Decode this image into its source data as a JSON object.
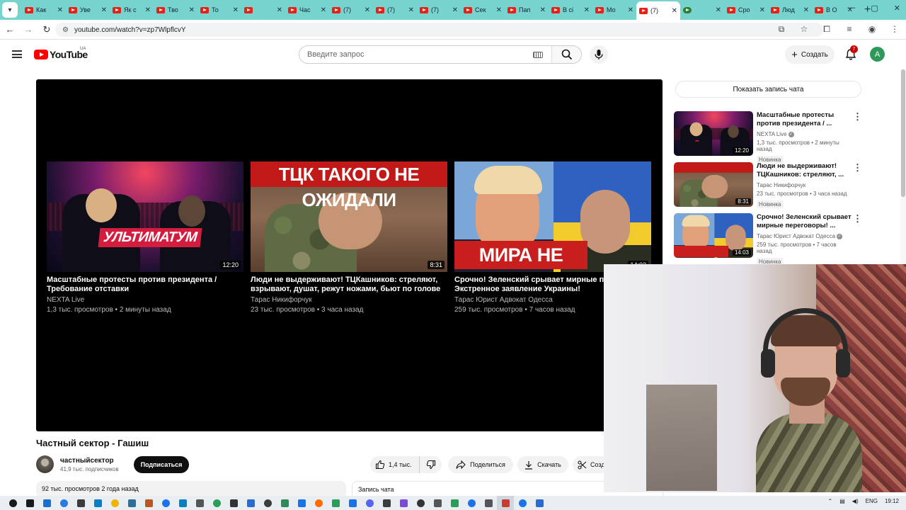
{
  "browser": {
    "tabs": [
      {
        "title": "Как",
        "icon": "youtube-favicon"
      },
      {
        "title": "Уве",
        "icon": "youtube-favicon"
      },
      {
        "title": "Як с",
        "icon": "youtube-favicon"
      },
      {
        "title": "Тво",
        "icon": "youtube-favicon"
      },
      {
        "title": "То",
        "icon": "youtube-favicon"
      },
      {
        "title": "",
        "icon": "youtube-favicon"
      },
      {
        "title": "Час",
        "icon": "youtube-favicon"
      },
      {
        "title": "(7)",
        "icon": "youtube-favicon"
      },
      {
        "title": "(7)",
        "icon": "youtube-favicon"
      },
      {
        "title": "(7)",
        "icon": "youtube-favicon"
      },
      {
        "title": "Сек",
        "icon": "youtube-favicon"
      },
      {
        "title": "Пап",
        "icon": "youtube-favicon"
      },
      {
        "title": "В сі",
        "icon": "youtube-favicon"
      },
      {
        "title": "Мо",
        "icon": "youtube-favicon"
      },
      {
        "title": "(7)",
        "icon": "youtube-favicon",
        "active": true
      },
      {
        "title": "",
        "icon": "generic-favicon"
      },
      {
        "title": "Сро",
        "icon": "youtube-favicon"
      },
      {
        "title": "Люд",
        "icon": "youtube-favicon"
      },
      {
        "title": "В О",
        "icon": "youtube-favicon"
      }
    ],
    "url": "youtube.com/watch?v=zp7WlpflcvY"
  },
  "youtube": {
    "logo_text": "YouTube",
    "region": "UA",
    "search_placeholder": "Введите запрос",
    "create_label": "Создать",
    "notifications_count": "7",
    "avatar_letter": "A"
  },
  "endscreen": [
    {
      "title": "Масштабные протесты против президента / Требование отставки",
      "channel": "NEXTA Live",
      "meta": "1,3 тыс. просмотров • 2 минуты назад",
      "duration": "12:20",
      "thumb_text": "УЛЬТИМАТУМ"
    },
    {
      "title": "Люди не выдерживают! ТЦКашников: стреляют, взрывают, душат, режут ножами, бьют по голове",
      "channel": "Тарас Никифорчук",
      "meta": "23 тыс. просмотров • 3 часа назад",
      "duration": "8:31",
      "thumb_text": "ТЦК ТАКОГО НЕ ОЖИДАЛИ"
    },
    {
      "title": "Срочно! Зеленский срывает мирные переговоры! Экстренное заявление Украины!",
      "channel": "Тарас Юрист Адвокат Одесса",
      "meta": "259 тыс. просмотров • 7 часов назад",
      "duration": "14:03",
      "thumb_text": "МИРА НЕ БУДЕТ"
    }
  ],
  "video": {
    "title": "Частный сектор - Гашиш",
    "channel_name": "частныйсектор",
    "subscribers": "41,9 тыс. подписчиков",
    "subscribe_label": "Подписаться",
    "likes": "1,4 тыс.",
    "share_label": "Поделиться",
    "download_label": "Скачать",
    "clip_label": "Созд",
    "description_meta": "92 тыс. просмотров  2 года назад",
    "chat_label": "Запись чата"
  },
  "sidebar": {
    "show_chat_label": "Показать запись чата",
    "recs": [
      {
        "title": "Масштабные протесты против президента / ...",
        "channel": "NEXTA Live",
        "verified": true,
        "meta": "1,3 тыс. просмотров • 2 минуты назад",
        "badge": "Новинка",
        "duration": "12:20"
      },
      {
        "title": "Люди не выдерживают! ТЦКашников: стреляют, ...",
        "channel": "Тарас Никифорчук",
        "verified": false,
        "meta": "23 тыс. просмотров • 3 часа назад",
        "badge": "Новинка",
        "duration": "8:31"
      },
      {
        "title": "Срочно! Зеленский срывает мирные переговоры! ...",
        "channel": "Тарас Юрист Адвокат Одесса",
        "verified": true,
        "meta": "259 тыс. просмотров • 7 часов назад",
        "badge": "Новинка",
        "duration": "14:03"
      }
    ]
  },
  "taskbar": {
    "language": "ENG",
    "time": "19:12"
  },
  "colors": {
    "tab_strip": "#77d3ce",
    "youtube_red": "#ff0000",
    "subscribe_bg": "#0f0f0f"
  }
}
